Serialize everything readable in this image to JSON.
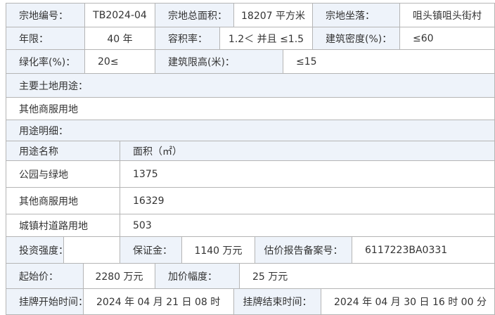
{
  "row1": {
    "parcel_no_label": "宗地编号：",
    "parcel_no_value": "TB2024-04",
    "total_area_label": "宗地总面积：",
    "total_area_value": "18207 平方米",
    "location_label": "宗地坐落：",
    "location_value": "咀头镇咀头街村"
  },
  "row2": {
    "term_label": "年限：",
    "term_value": "40 年",
    "far_label": "容积率：",
    "far_value": "1.2＜ 并且 ≤1.5",
    "density_label": "建筑密度(%)：",
    "density_value": "≤60"
  },
  "row3": {
    "green_label": "绿化率(%)：",
    "green_value": "20≤",
    "height_label": "建筑限高(米)：",
    "height_value": "≤15"
  },
  "main_use": {
    "label": "主要土地用途：",
    "value": "其他商服用地"
  },
  "use_detail": {
    "label": "用途明细：",
    "header_name": "用途名称",
    "header_area": "面积（㎡）",
    "rows": [
      {
        "name": "公园与绿地",
        "area": "1375"
      },
      {
        "name": "其他商服用地",
        "area": "16329"
      },
      {
        "name": "城镇村道路用地",
        "area": "503"
      }
    ]
  },
  "row_invest": {
    "intensity_label": "投资强度：",
    "intensity_value": "",
    "deposit_label": "保证金：",
    "deposit_value": "1140 万元",
    "appraisal_label": "估价报告备案号：",
    "appraisal_value": "6117223BA0331"
  },
  "row_price": {
    "start_label": "起始价：",
    "start_value": "2280 万元",
    "increment_label": "加价幅度：",
    "increment_value": "25 万元"
  },
  "row_time": {
    "start_time_label": "挂牌开始时间：",
    "start_time_value": "2024 年 04 月 21 日 08 时",
    "end_time_label": "挂牌结束时间：",
    "end_time_value": "2024 年 04 月 30 日 16 时 00 分"
  },
  "colors": {
    "label_bg": "#eef3fa",
    "border": "#b5b5b5",
    "text": "#333333"
  }
}
